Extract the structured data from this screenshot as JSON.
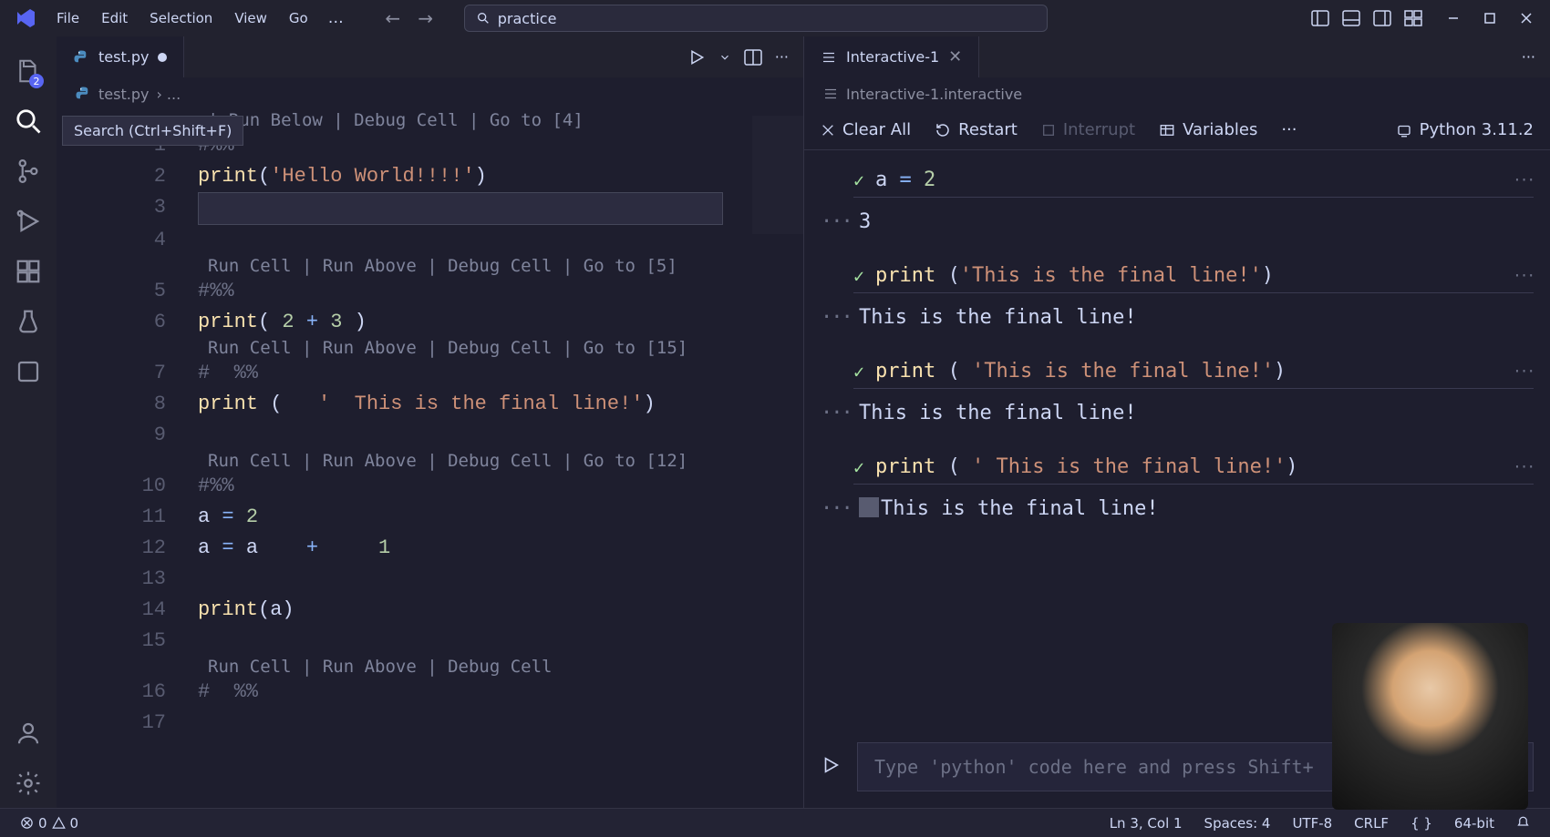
{
  "menu": {
    "file": "File",
    "edit": "Edit",
    "selection": "Selection",
    "view": "View",
    "go": "Go",
    "ellipsis": "…"
  },
  "search_placeholder": "practice",
  "tooltip_search": "Search (Ctrl+Shift+F)",
  "explorer_badge": "2",
  "left_tab": {
    "filename": "test.py",
    "breadcrumb_file": "test.py",
    "breadcrumb_rest": "› ..."
  },
  "codelens": {
    "c1": "| Run Below | Debug Cell | Go to [4]",
    "c2": "Run Cell | Run Above | Debug Cell | Go to [5]",
    "c3": "Run Cell | Run Above | Debug Cell | Go to [15]",
    "c4": "Run Cell | Run Above | Debug Cell | Go to [12]",
    "c5": "Run Cell | Run Above | Debug Cell"
  },
  "code": {
    "l1": "#%%",
    "l2_func": "print",
    "l2_paren_open": "(",
    "l2_str": "'Hello World!!!!'",
    "l2_paren_close": ")",
    "l5": "#%%",
    "l6_func": "print",
    "l6_rest_a": "( ",
    "l6_num1": "2",
    "l6_op": " + ",
    "l6_num2": "3",
    "l6_rest_b": " )",
    "l7": "#  %%",
    "l8_func": "print",
    "l8_rest_a": " (   ",
    "l8_str": "'  This is the final line!'",
    "l8_rest_b": ")",
    "l10": "#%%",
    "l11_a": "a ",
    "l11_eq": "= ",
    "l11_num": "2",
    "l12_a": "a ",
    "l12_eq": "= ",
    "l12_b": "a    ",
    "l12_op": "+",
    "l12_sp": "     ",
    "l12_num": "1",
    "l14_func": "print",
    "l14_rest": "(a)",
    "l16": "#  %%",
    "ln": {
      "1": "1",
      "2": "2",
      "3": "3",
      "4": "4",
      "5": "5",
      "6": "6",
      "7": "7",
      "8": "8",
      "9": "9",
      "10": "10",
      "11": "11",
      "12": "12",
      "13": "13",
      "14": "14",
      "15": "15",
      "16": "16",
      "17": "17"
    }
  },
  "right_tab": {
    "name": "Interactive-1",
    "breadcrumb": "Interactive-1.interactive"
  },
  "itool": {
    "clear": "Clear All",
    "restart": "Restart",
    "interrupt": "Interrupt",
    "variables": "Variables",
    "kernel": "Python 3.11.2"
  },
  "cells": {
    "c1_code_a": "a ",
    "c1_code_eq": "= ",
    "c1_code_num": "2",
    "c1_out": "3",
    "c2_func": "print",
    "c2_rest_a": " (",
    "c2_str": "'This is the final line!'",
    "c2_rest_b": ")",
    "c2_out": "This is the final line!",
    "c3_func": "print",
    "c3_rest_a": " ( ",
    "c3_str": "'This is the final line!'",
    "c3_rest_b": ")",
    "c3_out": "This is the final line!",
    "c4_func": "print",
    "c4_rest_a": " ( ",
    "c4_str": "' This is the final line!'",
    "c4_rest_b": ")",
    "c4_out": "This is the final line!",
    "expand": "···"
  },
  "input_placeholder": "Type 'python' code here and press Shift+",
  "status": {
    "errors": "0",
    "warnings": "0",
    "cursor": "Ln 3, Col 1",
    "spaces": "Spaces: 4",
    "encoding": "UTF-8",
    "eol": "CRLF",
    "lang_extra": "64-bit"
  }
}
